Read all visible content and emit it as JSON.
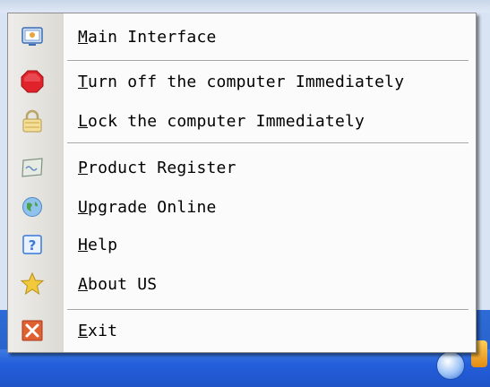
{
  "menu": {
    "items": [
      {
        "name": "main-interface",
        "icon": "monitor-icon",
        "mnemonic": "M",
        "rest": "ain Interface"
      },
      {
        "name": "turn-off-computer",
        "icon": "stop-icon",
        "mnemonic": "T",
        "rest": "urn off the computer Immediately"
      },
      {
        "name": "lock-computer",
        "icon": "lock-icon",
        "mnemonic": "L",
        "rest": "ock the computer Immediately"
      },
      {
        "name": "product-register",
        "icon": "register-card-icon",
        "mnemonic": "P",
        "rest": "roduct Register"
      },
      {
        "name": "upgrade-online",
        "icon": "globe-icon",
        "mnemonic": "U",
        "rest": "pgrade Online"
      },
      {
        "name": "help",
        "icon": "help-icon",
        "mnemonic": "H",
        "rest": "elp"
      },
      {
        "name": "about-us",
        "icon": "star-icon",
        "mnemonic": "A",
        "rest": "bout US"
      },
      {
        "name": "exit",
        "icon": "close-icon",
        "mnemonic": "E",
        "rest": "xit"
      }
    ]
  },
  "colors": {
    "stop": "#e0232b",
    "exit": "#e05a3a",
    "star": "#f2c93a",
    "help": "#3a78d8"
  }
}
